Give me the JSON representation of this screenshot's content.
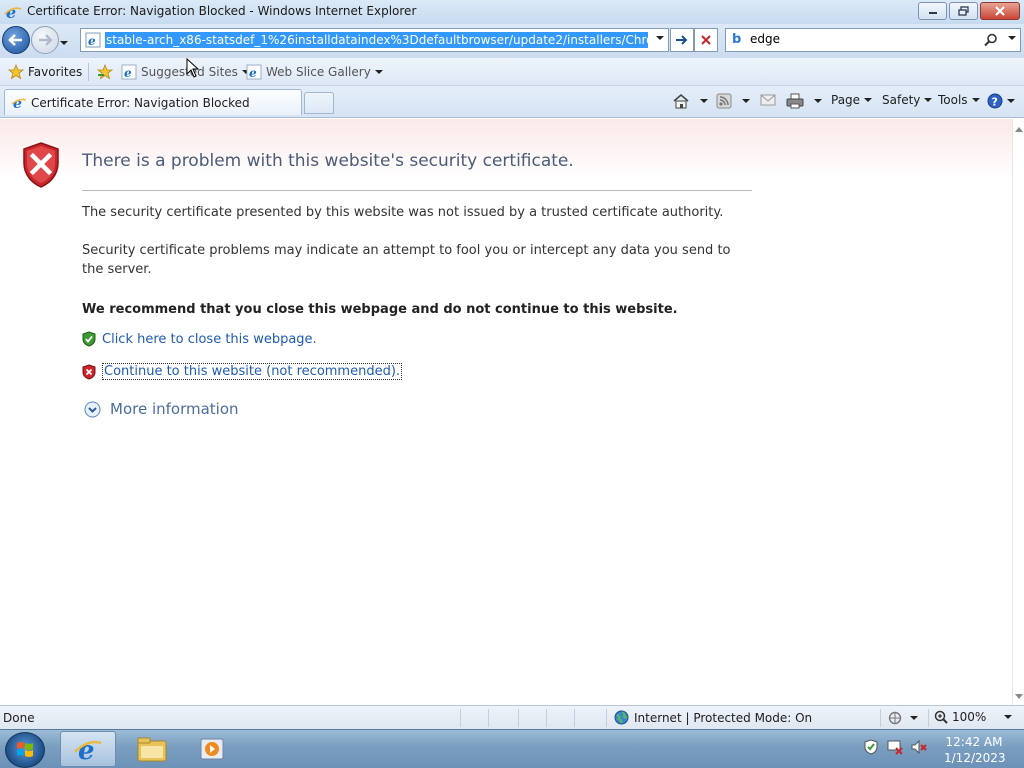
{
  "window": {
    "title": "Certificate Error: Navigation Blocked - Windows Internet Explorer"
  },
  "navbar": {
    "url": "stable-arch_x86-statsdef_1%26installdataindex%3Ddefaultbrowser/update2/installers/ChromeSetup.exe",
    "search_value": "edge"
  },
  "favorites_bar": {
    "favorites_label": "Favorites",
    "suggested_sites_label": "Suggested Sites",
    "web_slice_gallery_label": "Web Slice Gallery"
  },
  "tabs": {
    "active_tab_label": "Certificate Error: Navigation Blocked"
  },
  "command_bar": {
    "page_label": "Page",
    "safety_label": "Safety",
    "tools_label": "Tools"
  },
  "content": {
    "heading": "There is a problem with this website's security certificate.",
    "paragraph_1": "The security certificate presented by this website was not issued by a trusted certificate authority.",
    "paragraph_2": "Security certificate problems may indicate an attempt to fool you or intercept any data you send to the server.",
    "recommendation": "We recommend that you close this webpage and do not continue to this website.",
    "close_link": "Click here to close this webpage.",
    "continue_link": "Continue to this website (not recommended).",
    "more_information": "More information"
  },
  "status_bar": {
    "status": "Done",
    "zone": "Internet | Protected Mode: On",
    "zoom": "100%"
  },
  "taskbar": {
    "time": "12:42 AM",
    "date": "1/12/2023"
  },
  "colors": {
    "link": "#1f5bb0",
    "heading": "#4b5c77",
    "shield_red": "#c8262b",
    "shield_green": "#3b9a33",
    "url_highlight": "#3399ff"
  }
}
